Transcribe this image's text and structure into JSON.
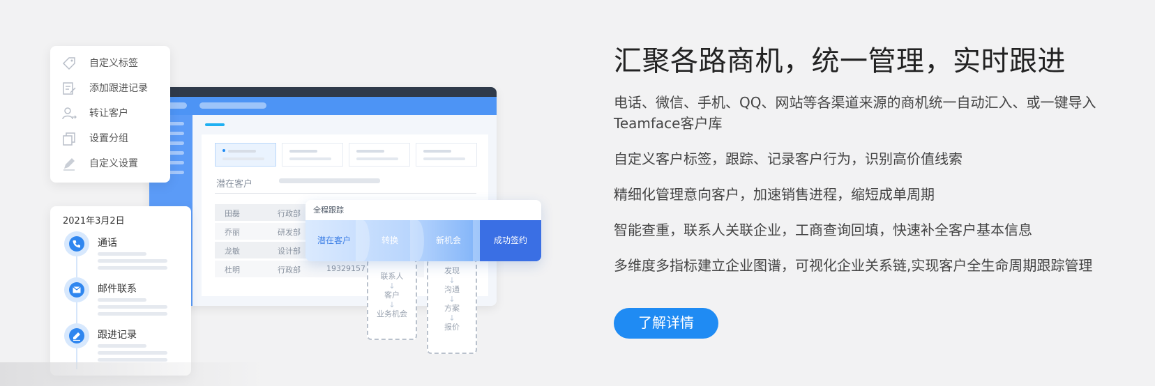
{
  "headline": "汇聚各路商机，统一管理，实时跟进",
  "features": [
    "电话、微信、手机、QQ、网站等各渠道来源的商机统一自动汇入、或一键导入Teamface客户库",
    "自定义客户标签，跟踪、记录客户行为，识别高价值线索",
    "精细化管理意向客户，加速销售进程，缩短成单周期",
    "智能查重，联系人关联企业，工商查询回填，快速补全客户基本信息",
    "多维度多指标建立企业图谱，可视化企业关系链,实现客户全生命周期跟踪管理"
  ],
  "cta_label": "了解详情",
  "accent_color": "#1f8bf3",
  "menu": {
    "items": [
      {
        "label": "自定义标签",
        "icon": "tag-icon"
      },
      {
        "label": "添加跟进记录",
        "icon": "edit-note-icon"
      },
      {
        "label": "转让客户",
        "icon": "user-transfer-icon"
      },
      {
        "label": "设置分组",
        "icon": "group-copy-icon"
      },
      {
        "label": "自定义设置",
        "icon": "pencil-icon"
      }
    ]
  },
  "timeline": {
    "date": "2021年3月2日",
    "items": [
      {
        "label": "通话",
        "icon": "phone-icon"
      },
      {
        "label": "邮件联系",
        "icon": "mail-icon"
      },
      {
        "label": "跟进记录",
        "icon": "edit-icon"
      }
    ]
  },
  "window": {
    "section_title": "潜在客户",
    "rows": [
      {
        "name": "田磊",
        "dept": "行政部",
        "phone": ""
      },
      {
        "name": "乔丽",
        "dept": "研发部",
        "phone": ""
      },
      {
        "name": "龙敏",
        "dept": "设计部",
        "phone": ""
      },
      {
        "name": "杜明",
        "dept": "行政部",
        "phone": "19329157"
      }
    ]
  },
  "flow": {
    "title": "全程跟踪",
    "stages": [
      "潜在客户",
      "转换",
      "新机会",
      "成功签约"
    ],
    "convert_sub": [
      "联系人",
      "客户",
      "业务机会"
    ],
    "opportunity_sub": [
      "发现",
      "沟通",
      "方案",
      "报价"
    ]
  }
}
